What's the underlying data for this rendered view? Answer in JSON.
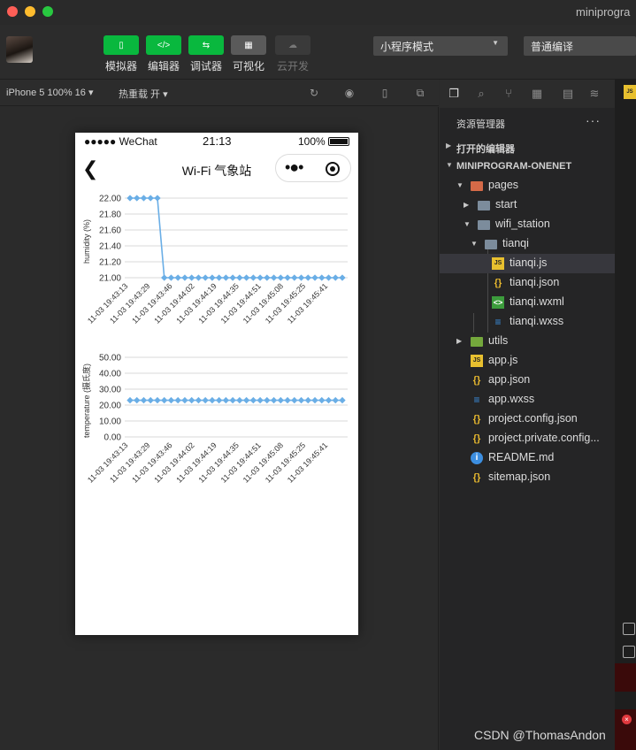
{
  "window": {
    "title": "miniprogra",
    "traffic_lights": [
      "close-icon",
      "minimize-icon",
      "maximize-icon"
    ]
  },
  "toolbar": {
    "buttons": [
      {
        "label": "模拟器",
        "icon": "phone-icon"
      },
      {
        "label": "编辑器",
        "icon": "code-icon"
      },
      {
        "label": "调试器",
        "icon": "debugger-icon"
      },
      {
        "label": "可视化",
        "icon": "layout-icon"
      },
      {
        "label": "云开发",
        "icon": "cloud-icon"
      }
    ],
    "mode_select": "小程序模式",
    "compile_select": "普通编译"
  },
  "simulator_bar": {
    "device": "iPhone 5 100% 16",
    "hot_reload": "热重载 开"
  },
  "phone": {
    "carrier": "●●●●● WeChat",
    "time": "21:13",
    "battery": "100%",
    "nav_title": "Wi-Fi 气象站",
    "capsule_more": "•●•"
  },
  "chart_data": [
    {
      "type": "line",
      "ylabel": "humidity (%)",
      "yticks": [
        "22.00",
        "21.80",
        "21.60",
        "21.40",
        "21.20",
        "21.00"
      ],
      "ylim": [
        21.0,
        22.0
      ],
      "grid": true,
      "x_tick_labels": [
        "11-03 19:43:13",
        "11-03 19:43:29",
        "11-03 19:43:46",
        "11-03 19:44:02",
        "11-03 19:44:19",
        "11-03 19:44:35",
        "11-03 19:44:51",
        "11-03 19:45:08",
        "11-03 19:45:25",
        "11-03 19:45:41"
      ],
      "series": [
        {
          "values": [
            22,
            22,
            22,
            22,
            22,
            21,
            21,
            21,
            21,
            21,
            21,
            21,
            21,
            21,
            21,
            21,
            21,
            21,
            21,
            21,
            21,
            21,
            21,
            21,
            21,
            21,
            21,
            21,
            21,
            21,
            21,
            21
          ]
        }
      ],
      "color": "#6aaee6"
    },
    {
      "type": "line",
      "ylabel": "temperature (摄氏度)",
      "yticks": [
        "50.00",
        "40.00",
        "30.00",
        "20.00",
        "10.00",
        "0.00"
      ],
      "ylim": [
        0,
        50
      ],
      "grid": true,
      "x_tick_labels": [
        "11-03 19:43:13",
        "11-03 19:43:29",
        "11-03 19:43:46",
        "11-03 19:44:02",
        "11-03 19:44:19",
        "11-03 19:44:35",
        "11-03 19:44:51",
        "11-03 19:45:08",
        "11-03 19:45:25",
        "11-03 19:45:41"
      ],
      "series": [
        {
          "values": [
            23,
            23,
            23,
            23,
            23,
            23,
            23,
            23,
            23,
            23,
            23,
            23,
            23,
            23,
            23,
            23,
            23,
            23,
            23,
            23,
            23,
            23,
            23,
            23,
            23,
            23,
            23,
            23,
            23,
            23,
            23,
            23
          ]
        }
      ],
      "color": "#6aaee6"
    }
  ],
  "explorer": {
    "title": "资源管理器",
    "more": "···",
    "open_editors": "打开的编辑器",
    "project": "MINIPROGRAM-ONENET",
    "tree": [
      {
        "name": "pages",
        "icon": "folder-icon"
      },
      {
        "name": "start",
        "icon": "folder-icon"
      },
      {
        "name": "wifi_station",
        "icon": "folder-icon"
      },
      {
        "name": "tianqi",
        "icon": "folder-icon"
      },
      {
        "name": "tianqi.js",
        "icon": "js-file-icon"
      },
      {
        "name": "tianqi.json",
        "icon": "json-file-icon"
      },
      {
        "name": "tianqi.wxml",
        "icon": "wxml-file-icon"
      },
      {
        "name": "tianqi.wxss",
        "icon": "wxss-file-icon"
      },
      {
        "name": "utils",
        "icon": "folder-icon"
      },
      {
        "name": "app.js",
        "icon": "js-file-icon"
      },
      {
        "name": "app.json",
        "icon": "json-file-icon"
      },
      {
        "name": "app.wxss",
        "icon": "wxss-file-icon"
      },
      {
        "name": "project.config.json",
        "icon": "json-file-icon"
      },
      {
        "name": "project.private.config...",
        "icon": "json-file-icon"
      },
      {
        "name": "README.md",
        "icon": "info-icon"
      },
      {
        "name": "sitemap.json",
        "icon": "json-file-icon"
      }
    ]
  },
  "watermark": "CSDN @ThomasAndon"
}
